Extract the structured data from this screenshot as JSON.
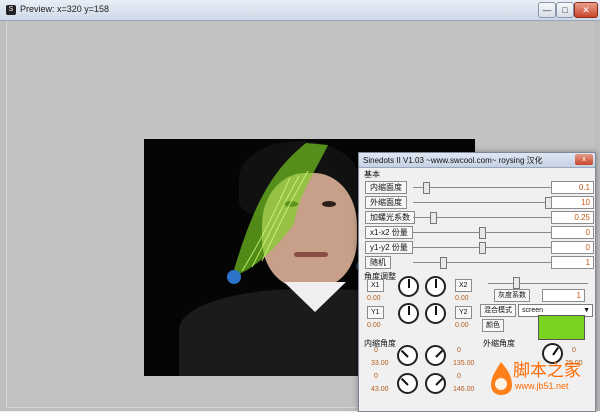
{
  "window": {
    "title": "Preview: x=320 y=158",
    "min_label": "—",
    "max_label": "□",
    "close_label": "✕"
  },
  "panel": {
    "title": "Sinedots II V1.03 ~www.swcool.com~ roysing 汉化",
    "close_label": "x",
    "sections": {
      "basic": "基本",
      "angle": "角度调整",
      "inner_angle": "内缩角度",
      "outer_angle": "外缩角度"
    },
    "basic_rows": [
      {
        "label": "内缩面度",
        "value": "0.1",
        "pos": 0.08
      },
      {
        "label": "外缩面度",
        "value": "10",
        "pos": 0.98
      },
      {
        "label": "加螺光系数",
        "value": "0.25",
        "pos": 0.12
      },
      {
        "label": "x1-x2 份量",
        "value": "0",
        "pos": 0.5
      },
      {
        "label": "y1-y2 份量",
        "value": "0",
        "pos": 0.5
      },
      {
        "label": "随机",
        "value": "1",
        "pos": 0.2
      }
    ],
    "knobs": {
      "x1": "X1",
      "x2": "X2",
      "y1": "Y1",
      "y2": "Y2",
      "val_top_left": "0.00",
      "val_top_right": "0.00",
      "val_mid_left": "0.00",
      "val_mid_right": "0.00",
      "inner_0": "0",
      "inner_1": "33.00",
      "inner_2": "0",
      "inner_3": "43.00",
      "mid_0": "0",
      "mid_1": "135.00",
      "mid_2": "0",
      "mid_3": "146.00",
      "outer_0": "0",
      "outer_1": "25.00"
    },
    "gray": {
      "label": "灰度系数",
      "value": "1",
      "pos": 0.5
    },
    "blend": {
      "label": "混合模式",
      "selected": "screen"
    },
    "color": {
      "label": "颜色",
      "swatch": "#7bd321"
    }
  },
  "watermark": {
    "brand": "脚本之家",
    "url": "www.jb51.net"
  },
  "colors": {
    "accent_green": "#7bd321",
    "watermark": "#ff6a00"
  }
}
